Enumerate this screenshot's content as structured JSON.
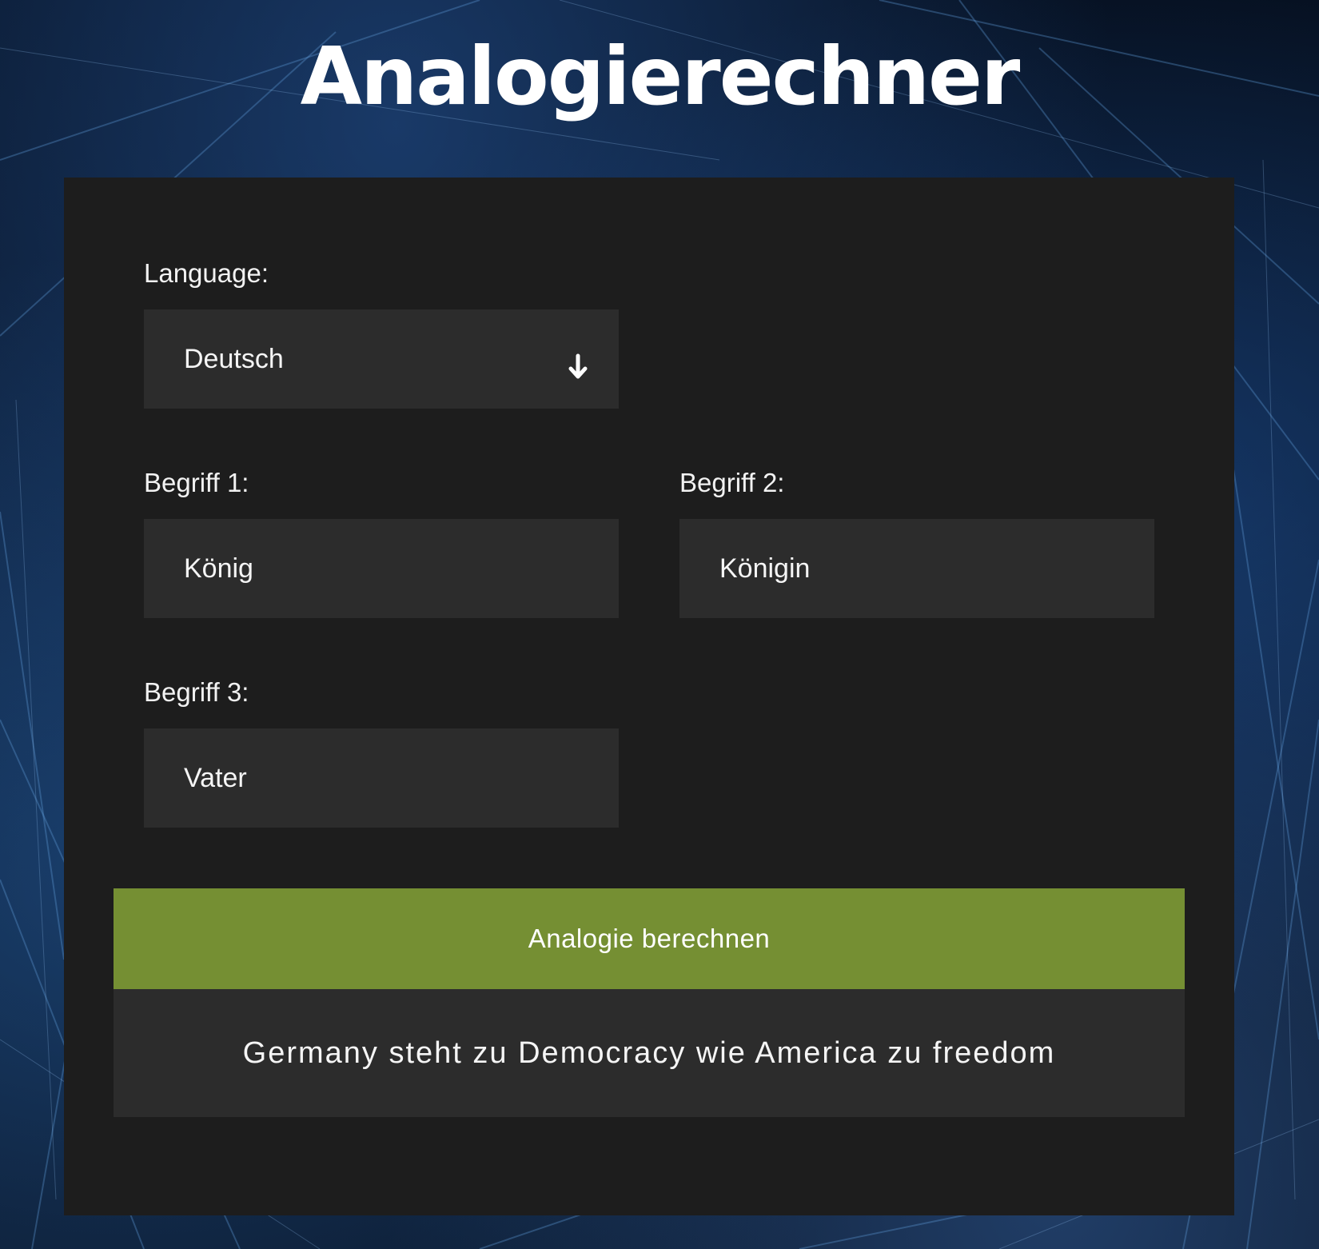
{
  "header": {
    "title": "Analogierechner"
  },
  "form": {
    "language": {
      "label": "Language:",
      "selected": "Deutsch",
      "arrow_icon": "arrow-down-icon"
    },
    "term1": {
      "label": "Begriff 1:",
      "value": "König"
    },
    "term2": {
      "label": "Begriff 2:",
      "value": "Königin"
    },
    "term3": {
      "label": "Begriff 3:",
      "value": "Vater"
    },
    "submit_label": "Analogie berechnen"
  },
  "result": {
    "text": "Germany steht zu Democracy wie America zu freedom"
  },
  "colors": {
    "button": "#758f33",
    "panel": "#1d1d1d",
    "field": "#2c2c2c"
  }
}
